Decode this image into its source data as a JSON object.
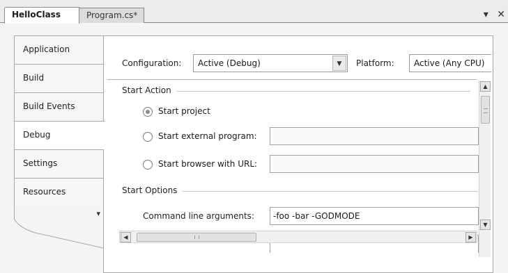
{
  "tabs": [
    {
      "label": "HelloClass",
      "active": true
    },
    {
      "label": "Program.cs*",
      "active": false
    }
  ],
  "window_controls": {
    "dropdown_icon": "chevron-down-icon",
    "close_icon": "close-icon",
    "dropdown_glyph": "▾",
    "close_glyph": "✕"
  },
  "sidebar": {
    "items": [
      {
        "label": "Application"
      },
      {
        "label": "Build"
      },
      {
        "label": "Build Events"
      },
      {
        "label": "Debug",
        "active": true
      },
      {
        "label": "Settings"
      },
      {
        "label": "Resources"
      }
    ],
    "overflow_glyph": "▾"
  },
  "config": {
    "configuration_label": "Configuration:",
    "configuration_value": "Active (Debug)",
    "platform_label": "Platform:",
    "platform_value": "Active (Any CPU)"
  },
  "start_action": {
    "title": "Start Action",
    "options": [
      {
        "label": "Start project",
        "checked": true
      },
      {
        "label": "Start external program:",
        "checked": false,
        "value": ""
      },
      {
        "label": "Start browser with URL:",
        "checked": false,
        "value": ""
      }
    ]
  },
  "start_options": {
    "title": "Start Options",
    "command_line_label": "Command line arguments:",
    "command_line_value": "-foo -bar -GODMODE"
  },
  "scrollbars": {
    "up_glyph": "▲",
    "down_glyph": "▼",
    "left_glyph": "◀",
    "right_glyph": "▶"
  }
}
